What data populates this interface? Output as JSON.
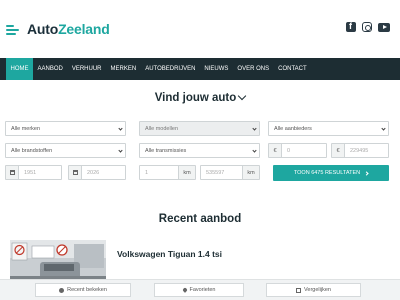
{
  "brand": {
    "name_part1": "Auto",
    "name_part2": "Zeeland",
    "accent_color": "#1ea7a0",
    "dark_color": "#1d2d33"
  },
  "socials": [
    {
      "icon": "facebook-icon"
    },
    {
      "icon": "instagram-icon"
    },
    {
      "icon": "youtube-icon"
    }
  ],
  "nav": {
    "items": [
      {
        "label": "HOME",
        "active": true
      },
      {
        "label": "AANBOD"
      },
      {
        "label": "VERHUUR"
      },
      {
        "label": "MERKEN"
      },
      {
        "label": "AUTOBEDRIJVEN"
      },
      {
        "label": "NIEUWS"
      },
      {
        "label": "OVER ONS"
      },
      {
        "label": "CONTACT"
      }
    ]
  },
  "search": {
    "title": "Vind jouw auto",
    "merken": "Alle merken",
    "modellen": "Alle modellen",
    "aanbieders": "Alle aanbieders",
    "brandstoffen": "Alle brandstoffen",
    "transmissies": "Alle transmissies",
    "price_currency": "€",
    "price_min_placeholder": "0",
    "price_max_placeholder": "229495",
    "year_min_placeholder": "1951",
    "year_max_placeholder": "2026",
    "km_min_placeholder": "1",
    "km_max_placeholder": "535597",
    "km_unit": "km",
    "results_button": "TOON 6475 RESULTATEN"
  },
  "recent": {
    "title": "Recent aanbod",
    "card_title": "Volkswagen Tiguan 1.4 tsi"
  },
  "bottom_bar": {
    "recent_label": "Recent bekeken",
    "favorites_label": "Favorieten",
    "compare_label": "Vergelijken"
  }
}
